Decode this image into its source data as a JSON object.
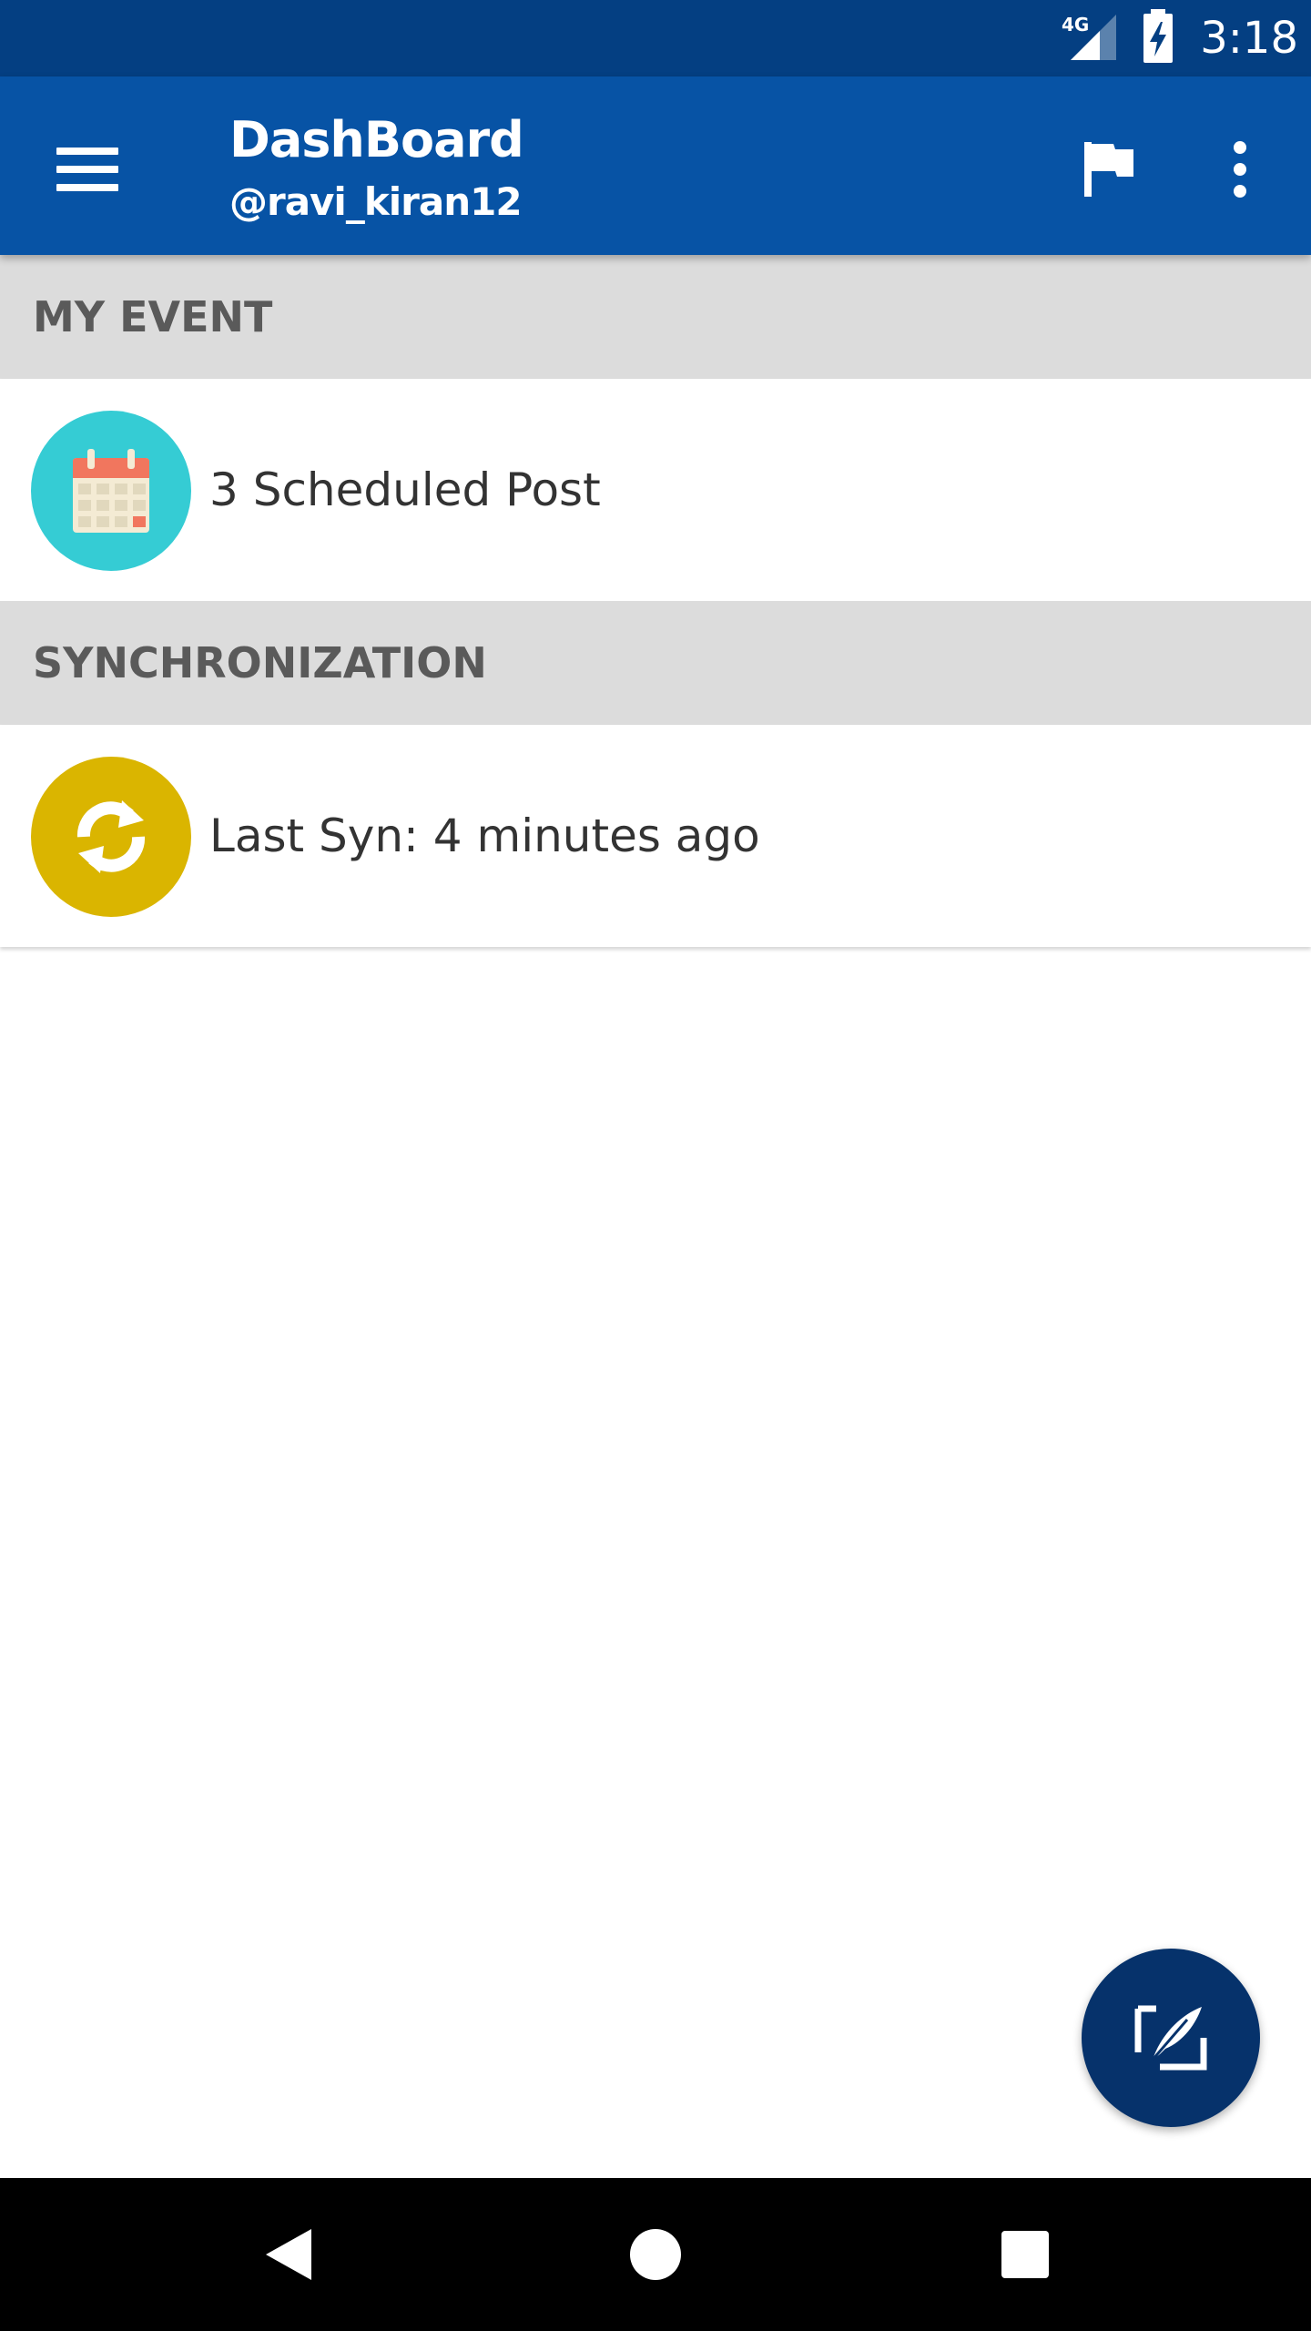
{
  "status_bar": {
    "network": "4G",
    "time": "3:18"
  },
  "app_bar": {
    "title": "DashBoard",
    "subtitle": "@ravi_kiran12",
    "color": "#0753a5"
  },
  "sections": [
    {
      "header": "MY EVENT",
      "row_text": "3 Scheduled Post",
      "icon": "calendar-icon",
      "icon_bg": "#35ccd4"
    },
    {
      "header": "SYNCHRONIZATION",
      "row_text": "Last Syn: 4 minutes ago",
      "icon": "sync-icon",
      "icon_bg": "#dab500"
    }
  ],
  "fab": {
    "icon": "compose-quill-icon",
    "color": "#06326b"
  },
  "nav_bar": {
    "icons": [
      "back-icon",
      "home-icon",
      "recents-icon"
    ]
  }
}
